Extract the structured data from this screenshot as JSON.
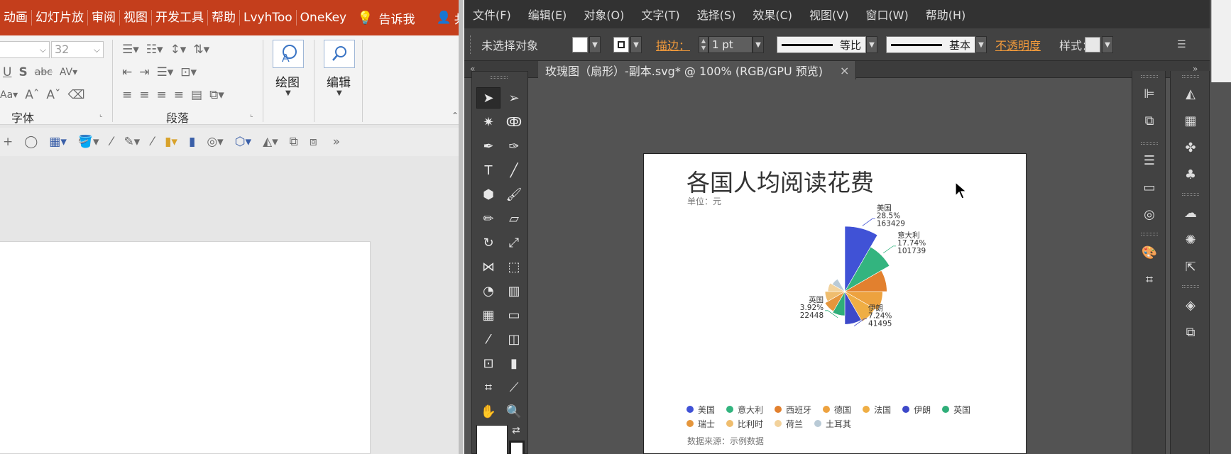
{
  "ppt": {
    "menu_tabs": [
      "动画",
      "幻灯片放",
      "审阅",
      "视图",
      "开发工具",
      "帮助",
      "LvyhToo",
      "OneKey"
    ],
    "tell_me": "告诉我",
    "share": "共享",
    "font_size": "32",
    "group_font": "字体",
    "group_paragraph": "段落",
    "drawing_label": "绘图",
    "editing_label": "编辑"
  },
  "ai": {
    "menu": [
      "文件(F)",
      "编辑(E)",
      "对象(O)",
      "文字(T)",
      "选择(S)",
      "效果(C)",
      "视图(V)",
      "窗口(W)",
      "帮助(H)"
    ],
    "control": {
      "no_selection": "未选择对象",
      "stroke_label": "描边：",
      "stroke_value": "1 pt",
      "profile1": "等比",
      "profile2": "基本",
      "opacity_label": "不透明度",
      "style_label": "样式："
    },
    "doc_tab": "玫瑰图（扇形）-副本.svg* @ 100% (RGB/GPU 预览)",
    "doc_close": "×"
  },
  "chart_data": {
    "type": "pie",
    "subtype": "rose",
    "title": "各国人均阅读花费",
    "unit": "单位：元",
    "source": "数据来源：示例数据",
    "legend_position": "bottom",
    "slices": [
      {
        "name": "美国",
        "percent": "28.5%",
        "value": 163429,
        "color": "#4052d6"
      },
      {
        "name": "意大利",
        "percent": "17.74%",
        "value": 101739,
        "color": "#33b47f"
      },
      {
        "name": "西班牙",
        "percent": "",
        "value": 68000,
        "color": "#e2802e"
      },
      {
        "name": "德国",
        "percent": "",
        "value": 55000,
        "color": "#eda23f"
      },
      {
        "name": "法国",
        "percent": "",
        "value": 46000,
        "color": "#efae45"
      },
      {
        "name": "伊朗",
        "percent": "7.24%",
        "value": 41495,
        "color": "#3d49c9"
      },
      {
        "name": "英国",
        "percent": "3.92%",
        "value": 22448,
        "color": "#2fae79"
      },
      {
        "name": "瑞士",
        "percent": "",
        "value": 20000,
        "color": "#e5963c"
      },
      {
        "name": "比利时",
        "percent": "",
        "value": 15000,
        "color": "#efbd6e"
      },
      {
        "name": "荷兰",
        "percent": "",
        "value": 11000,
        "color": "#f2d29c"
      },
      {
        "name": "土耳其",
        "percent": "",
        "value": 8000,
        "color": "#b9cad6"
      }
    ],
    "labeled_slices": [
      "美国",
      "意大利",
      "伊朗",
      "英国"
    ]
  }
}
